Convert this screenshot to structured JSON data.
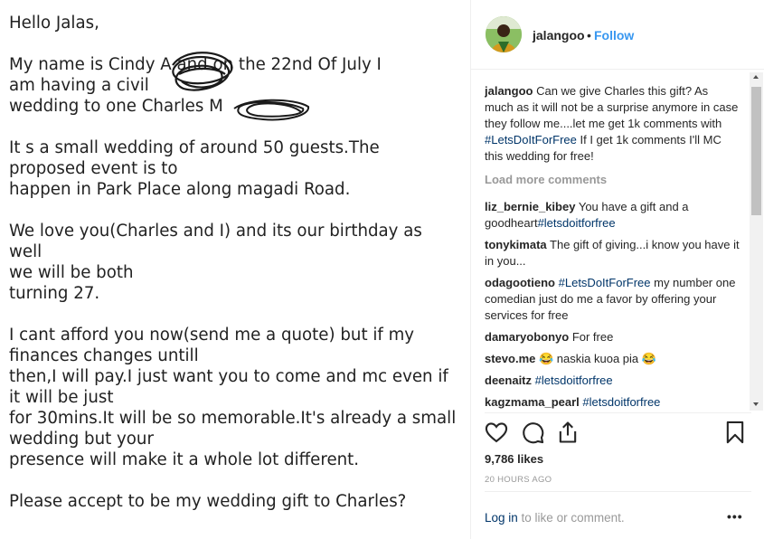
{
  "letter": {
    "greeting": "Hello Jalas,",
    "p1": "My name is Cindy A        and on the 22nd Of July I\nam having a civil\nwedding to one Charles M",
    "p2": "It s a small wedding  of around 50 guests.The\nproposed event is to\nhappen in Park Place along magadi Road.",
    "p3": "We love you(Charles and I) and its our birthday as well\nwe will be both\nturning 27.",
    "p4": "I cant afford you now(send me a quote) but if my\nfinances changes untill\nthen,I will pay.I just want you to come and mc even if\nit will be just\nfor 30mins.It will be so memorable.It's already a small\nwedding but your\npresence will make it a whole lot different.",
    "p5": "Please accept to be my wedding gift to Charles?"
  },
  "header": {
    "username": "jalangoo",
    "separator": "•",
    "follow": "Follow"
  },
  "caption": {
    "user": "jalangoo",
    "text1": "Can we give Charles this gift? As much as it will not be a surprise anymore in case they follow me....let me get 1k comments with ",
    "tag": "#LetsDoItForFree",
    "text2": " If I get 1k comments I'll MC this wedding for free!"
  },
  "load_more": "Load more comments",
  "comments": [
    {
      "user": "liz_bernie_kibey",
      "text": "You have a gift and a goodheart",
      "tag": "#letsdoitforfree"
    },
    {
      "user": "tonykimata",
      "text": "The gift of giving...i know you have it in you...",
      "tag": ""
    },
    {
      "user": "odagootieno",
      "text": "",
      "tag": "#LetsDoItForFree",
      "text_after": " my number one comedian just do me a favor by offering your services for free"
    },
    {
      "user": "damaryobonyo",
      "text": "For free",
      "tag": ""
    },
    {
      "user": "stevo.me",
      "text": "😂 naskia kuoa pia 😂",
      "tag": ""
    },
    {
      "user": "deenaitz",
      "text": "",
      "tag": "#letsdoitforfree"
    },
    {
      "user": "kagzmama_pearl",
      "text": "",
      "tag": "#letsdoitforfree"
    }
  ],
  "likes": "9,786 likes",
  "time": "20 HOURS AGO",
  "login": {
    "link": "Log in",
    "rest": " to like or comment."
  },
  "more": "•••",
  "icons": {
    "like": "heart-icon",
    "comment": "comment-icon",
    "share": "share-icon",
    "save": "bookmark-icon",
    "more": "more-options-icon"
  },
  "colors": {
    "link": "#003569",
    "follow": "#3897f0",
    "muted": "#999999",
    "text": "#262626"
  }
}
